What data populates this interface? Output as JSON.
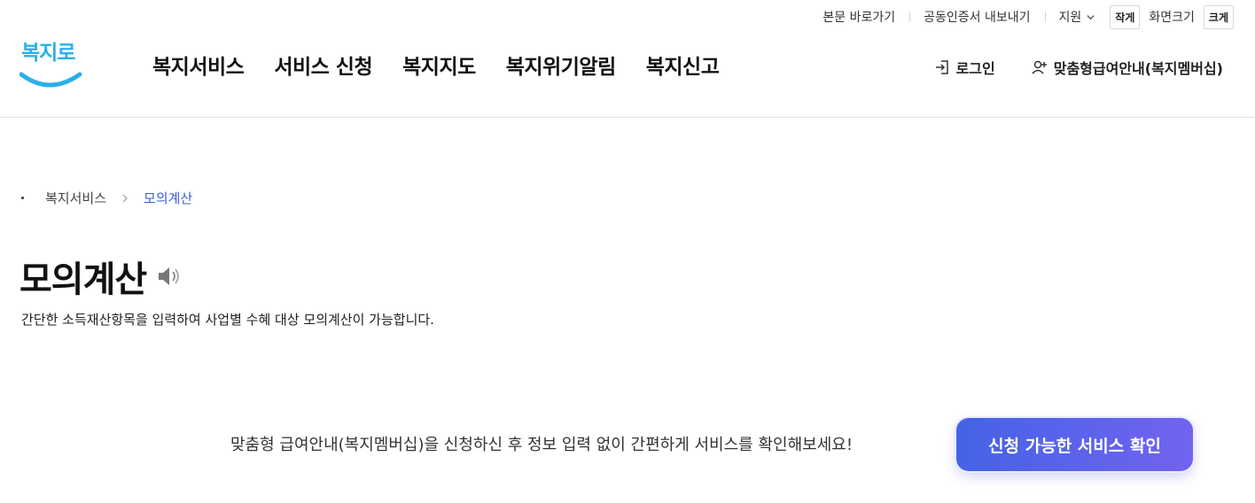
{
  "utility": {
    "skip_to_content": "본문 바로가기",
    "cert_export": "공동인증서 내보내기",
    "support": "지원",
    "size_small": "작게",
    "size_label": "화면크기",
    "size_large": "크게"
  },
  "logo": {
    "text": "복지로"
  },
  "gnb": {
    "items": [
      {
        "label": "복지서비스"
      },
      {
        "label": "서비스 신청"
      },
      {
        "label": "복지지도"
      },
      {
        "label": "복지위기알림"
      },
      {
        "label": "복지신고"
      }
    ]
  },
  "user_menu": {
    "login": "로그인",
    "membership": "맞춤형급여안내(복지멤버십)"
  },
  "breadcrumb": {
    "parent": "복지서비스",
    "current": "모의계산"
  },
  "page": {
    "title": "모의계산",
    "description": "간단한 소득재산항목을 입력하여 사업별 수혜 대상 모의계산이 가능합니다."
  },
  "cta": {
    "text": "맞춤형 급여안내(복지멤버십)을 신청하신 후 정보 입력 없이 간편하게 서비스를 확인해보세요!",
    "button": "신청 가능한 서비스 확인"
  },
  "colors": {
    "accent": "#3a5fd9",
    "logo": "#2ab0e8",
    "cta_gradient_start": "#4463e6",
    "cta_gradient_end": "#7263f0"
  }
}
